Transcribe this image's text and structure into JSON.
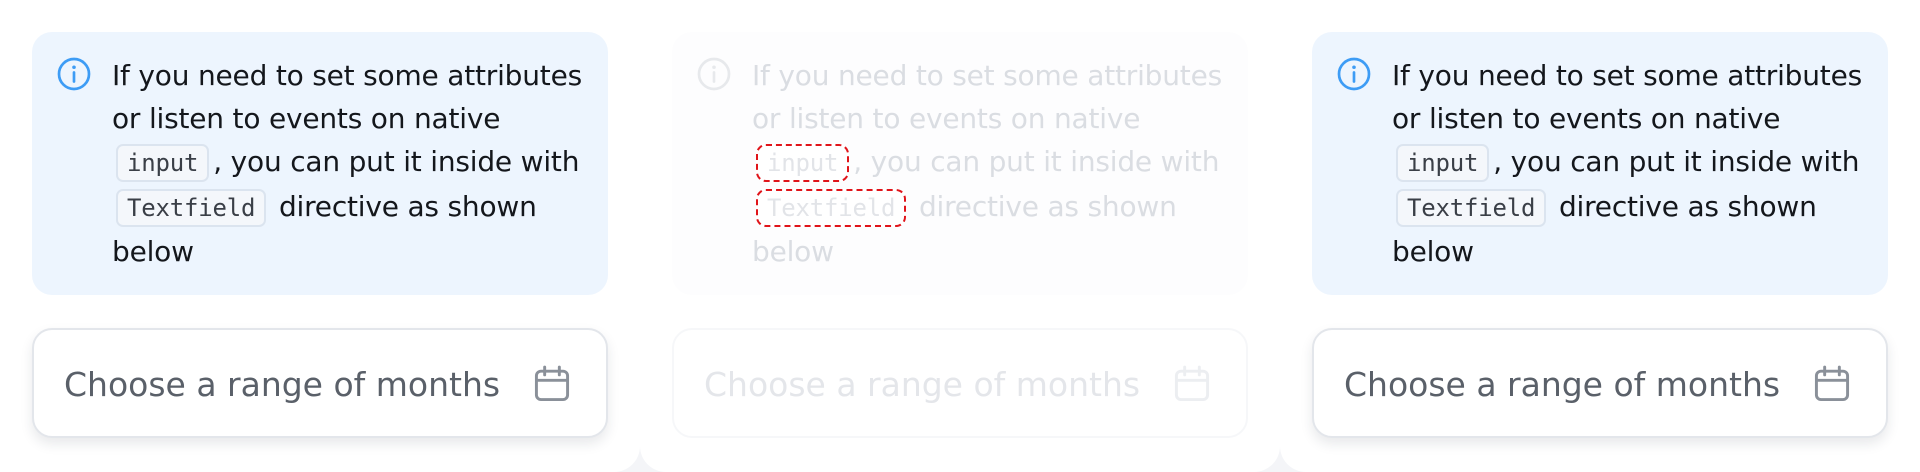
{
  "alert": {
    "line1": "If you need to set some attributes or listen to events on native",
    "code_input": "input",
    "comma": ",",
    "line2": "you can put it inside with",
    "code_textfield": "Textfield",
    "line3": "directive as shown below"
  },
  "textfield": {
    "placeholder": "Choose a range of months"
  },
  "icons": {
    "info": "info-circle-icon",
    "calendar": "calendar-icon"
  },
  "colors": {
    "accent": "#3d9cf5",
    "alert_bg": "#edf5fe",
    "highlight": "#e0141a"
  }
}
